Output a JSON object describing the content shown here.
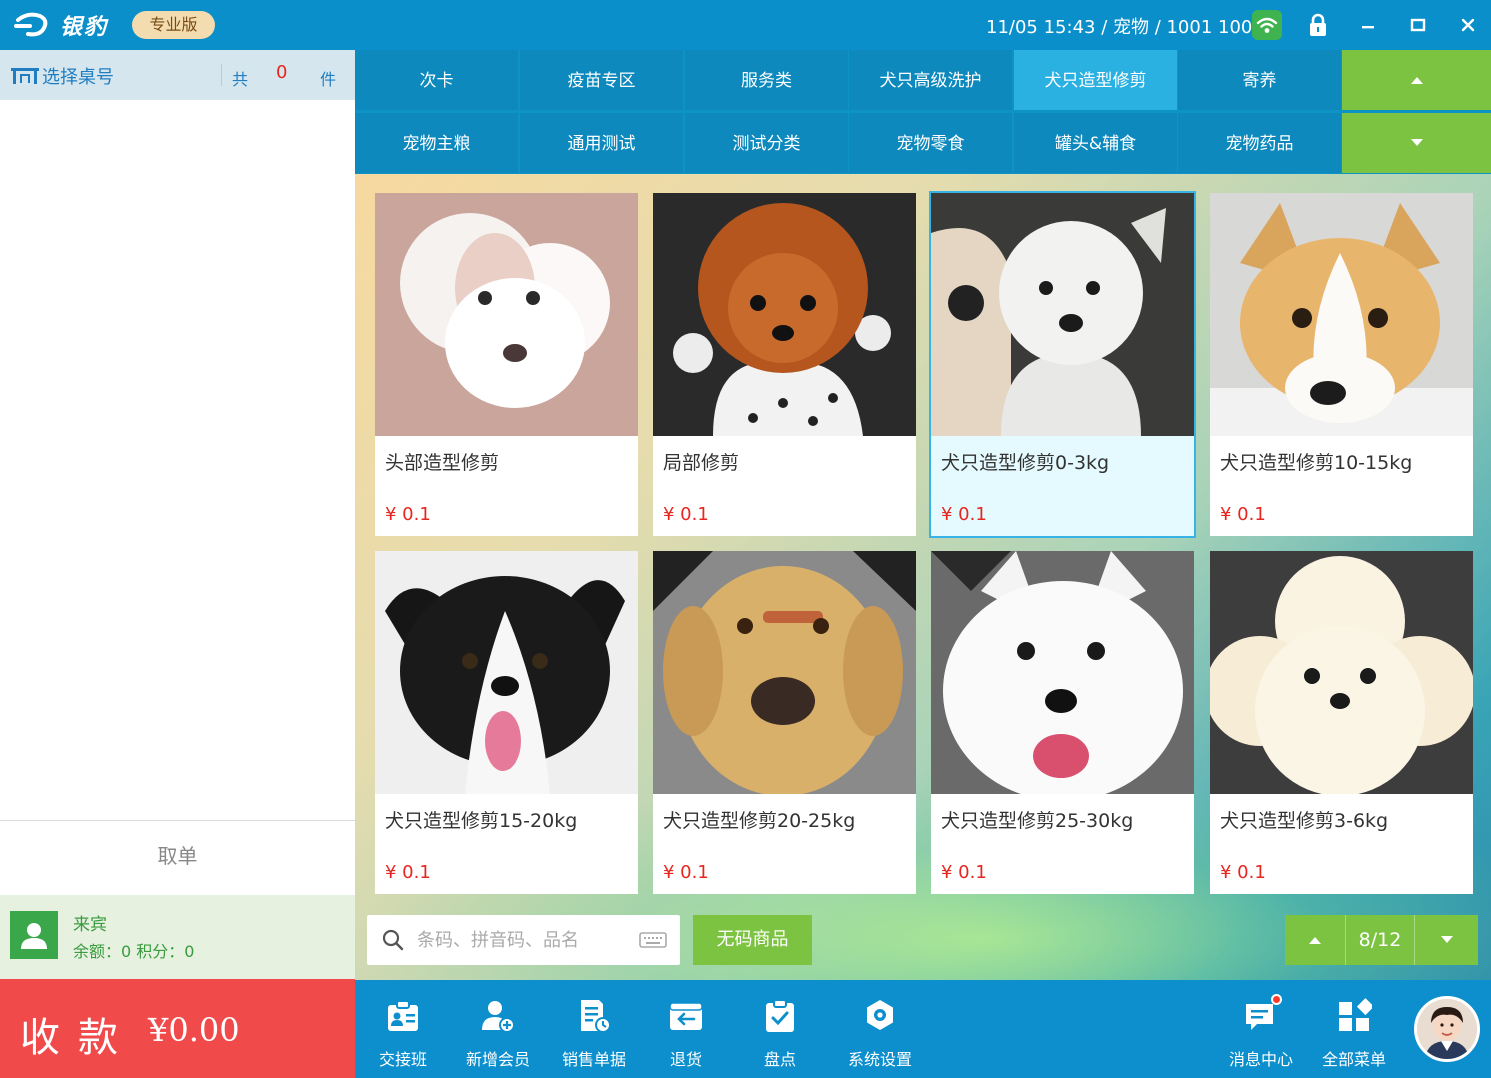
{
  "app": {
    "logo_text": "银豹",
    "edition": "专业版",
    "status": "11/05 15:43 / 宠物 / 1001 1001"
  },
  "left_panel": {
    "table_label": "选择桌号",
    "count_prefix": "共",
    "count_value": "0",
    "count_unit": "件",
    "cancel_label": "取单",
    "member_name": "来宾",
    "member_info": "余额：0  积分：0",
    "checkout_label": "收款",
    "checkout_amount": "¥0.00"
  },
  "categories": {
    "row1": [
      "次卡",
      "疫苗专区",
      "服务类",
      "犬只高级洗护",
      "犬只造型修剪",
      "寄养"
    ],
    "row2": [
      "宠物主粮",
      "通用测试",
      "测试分类",
      "宠物零食",
      "罐头&辅食",
      "宠物药品"
    ],
    "active": "犬只造型修剪"
  },
  "products": [
    {
      "name": "头部造型修剪",
      "price": "¥ 0.1"
    },
    {
      "name": "局部修剪",
      "price": "¥ 0.1"
    },
    {
      "name": "犬只造型修剪0-3kg",
      "price": "¥ 0.1"
    },
    {
      "name": "犬只造型修剪10-15kg",
      "price": "¥ 0.1"
    },
    {
      "name": "犬只造型修剪15-20kg",
      "price": "¥ 0.1"
    },
    {
      "name": "犬只造型修剪20-25kg",
      "price": "¥ 0.1"
    },
    {
      "name": "犬只造型修剪25-30kg",
      "price": "¥ 0.1"
    },
    {
      "name": "犬只造型修剪3-6kg",
      "price": "¥ 0.1"
    }
  ],
  "search": {
    "placeholder": "条码、拼音码、品名",
    "value": ""
  },
  "no_code_label": "无码商品",
  "pager": {
    "text": "8/12"
  },
  "toolbar": {
    "handover": "交接班",
    "add_member": "新增会员",
    "sales_docs": "销售单据",
    "returns": "退货",
    "inventory": "盘点",
    "settings": "系统设置",
    "messages": "消息中心",
    "all_menu": "全部菜单"
  },
  "colors": {
    "primary": "#0a8fcb",
    "accent_green": "#7dc342",
    "checkout_red": "#f04a4a",
    "price_red": "#e8261f",
    "selected_card": "#e4fafe"
  }
}
